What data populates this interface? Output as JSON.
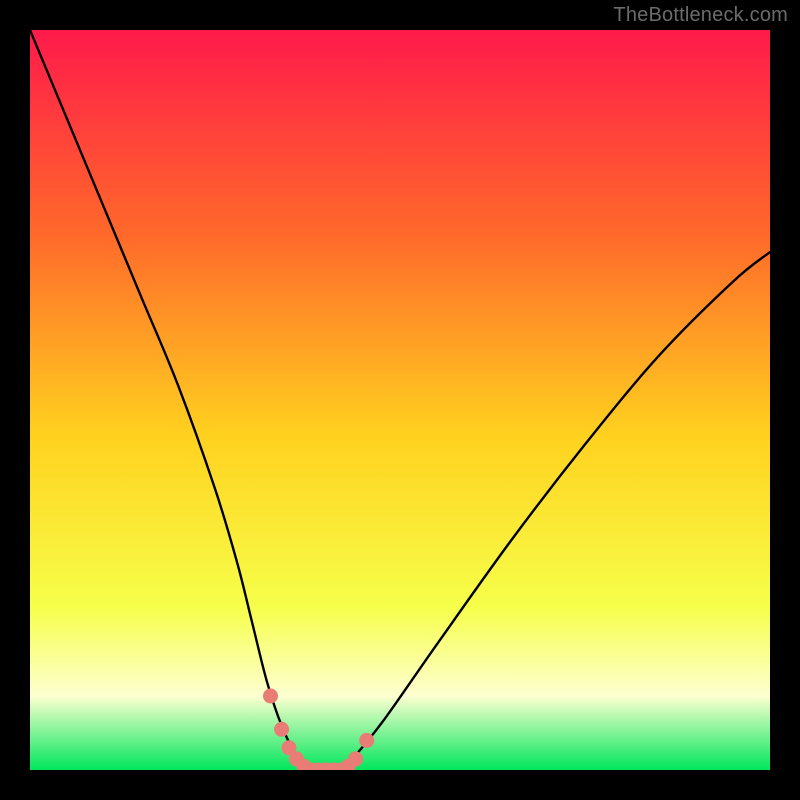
{
  "watermark": "TheBottleneck.com",
  "colors": {
    "frame": "#000000",
    "gradient_top": "#ff1a4b",
    "gradient_upper_mid": "#ff6a2a",
    "gradient_mid": "#ffd21f",
    "gradient_lower_mid": "#f6ff4a",
    "gradient_pale": "#fdffd0",
    "gradient_bottom": "#00e65c",
    "curve": "#000000",
    "marker": "#e97c74"
  },
  "chart_data": {
    "type": "line",
    "title": "",
    "xlabel": "",
    "ylabel": "",
    "xlim": [
      0,
      100
    ],
    "ylim": [
      0,
      100
    ],
    "annotations": [],
    "series": [
      {
        "name": "bottleneck-curve",
        "x": [
          0,
          5,
          10,
          15,
          20,
          25,
          28,
          30,
          32,
          34,
          36,
          38,
          40,
          42,
          44,
          48,
          55,
          65,
          75,
          85,
          95,
          100
        ],
        "values": [
          100,
          88,
          76,
          64,
          52,
          38,
          28,
          20,
          12,
          6,
          2,
          0,
          0,
          0,
          2,
          7,
          17,
          31,
          44,
          56,
          66,
          70
        ]
      }
    ],
    "markers": {
      "name": "highlight-dots",
      "x": [
        32.5,
        34.0,
        35.0,
        36.0,
        37.0,
        38.0,
        39.0,
        40.0,
        41.0,
        42.0,
        43.0,
        44.0,
        45.5
      ],
      "values": [
        10.0,
        5.5,
        3.0,
        1.5,
        0.5,
        0.0,
        0.0,
        0.0,
        0.0,
        0.0,
        0.5,
        1.5,
        4.0
      ]
    }
  }
}
